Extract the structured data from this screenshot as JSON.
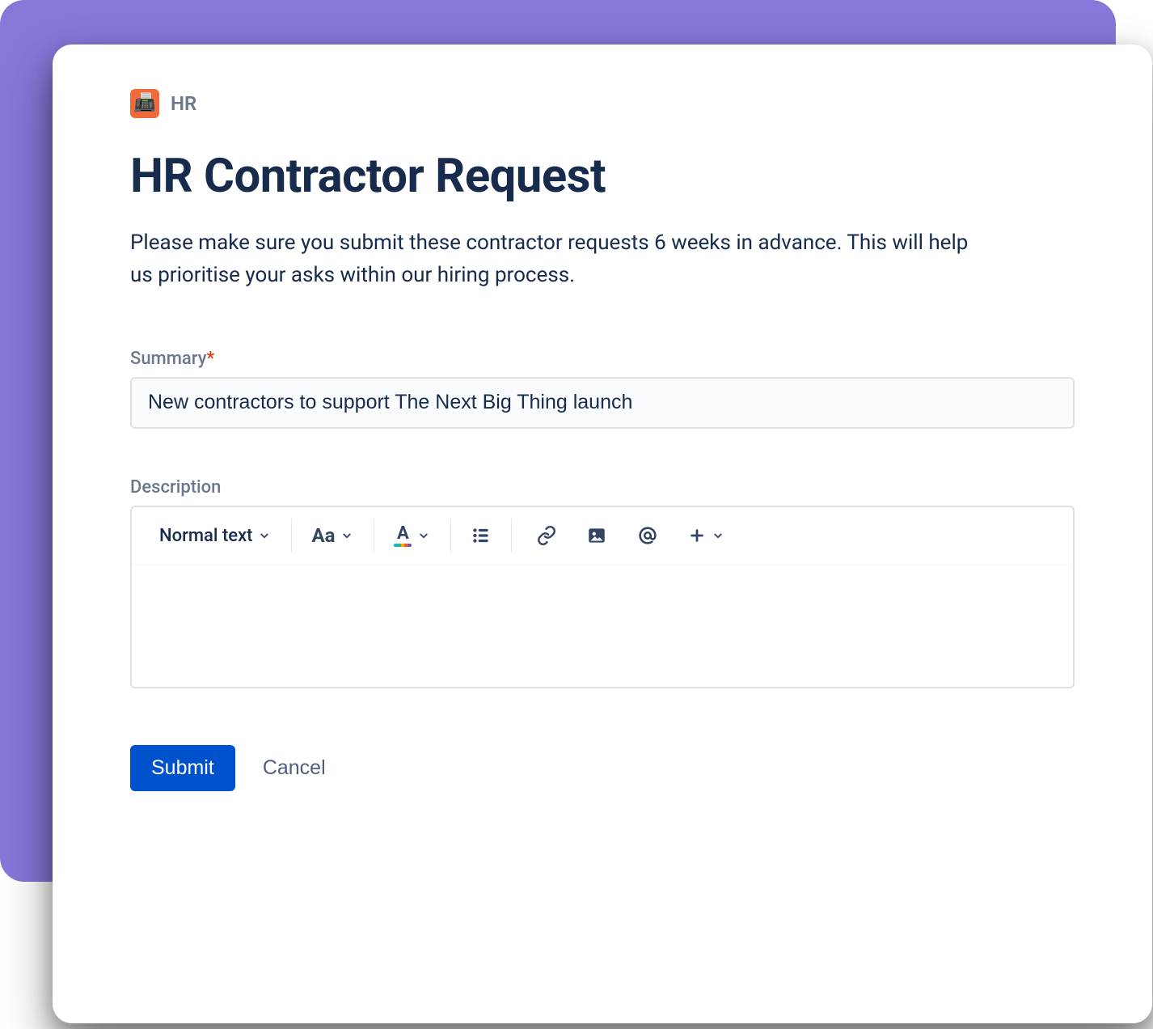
{
  "breadcrumb": {
    "icon_emoji": "📠",
    "label": "HR"
  },
  "title": "HR Contractor Request",
  "intro": "Please make sure you submit these contractor requests 6 weeks in advance. This will help us prioritise your asks within our hiring process.",
  "summary": {
    "label": "Summary",
    "required_marker": "*",
    "value": "New contractors to support The Next Big Thing launch"
  },
  "description": {
    "label": "Description",
    "value": ""
  },
  "toolbar": {
    "text_style_label": "Normal text"
  },
  "actions": {
    "submit_label": "Submit",
    "cancel_label": "Cancel"
  }
}
